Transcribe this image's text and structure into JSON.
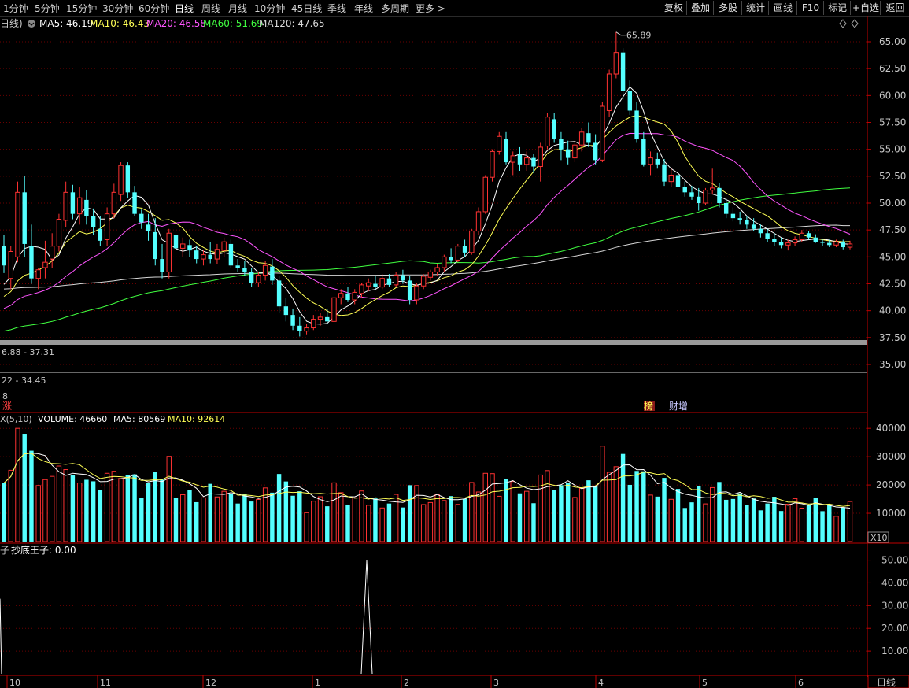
{
  "toolbar": {
    "periods": [
      {
        "label": "1分钟",
        "active": false
      },
      {
        "label": "5分钟",
        "active": false
      },
      {
        "label": "15分钟",
        "active": false
      },
      {
        "label": "30分钟",
        "active": false
      },
      {
        "label": "60分钟",
        "active": false
      },
      {
        "label": "日线",
        "active": true
      },
      {
        "label": "周线",
        "active": false
      },
      {
        "label": "月线",
        "active": false
      },
      {
        "label": "10分钟",
        "active": false
      },
      {
        "label": "45日线",
        "active": false
      },
      {
        "label": "季线",
        "active": false
      },
      {
        "label": "年线",
        "active": false
      },
      {
        "label": "多周期",
        "active": false
      },
      {
        "label": "更多 >",
        "active": false
      }
    ],
    "buttons": [
      "复权",
      "叠加",
      "多股",
      "统计",
      "画线",
      "F10",
      "标记",
      "+自选",
      "返回"
    ]
  },
  "colors": {
    "up": "#ff3232",
    "down": "#54ffff",
    "ma5": "#ffffff",
    "ma10": "#ffff55",
    "ma20": "#ff55ff",
    "ma60": "#40ff40",
    "ma120": "#d8d8d8",
    "axis": "#c00000",
    "grid": "#6a0000"
  },
  "price_panel": {
    "period_label": "日线)",
    "ma_legend": [
      {
        "label": "MA5: 46.19",
        "color": "#ffffff"
      },
      {
        "label": "MA10: 46.43",
        "color": "#ffff55"
      },
      {
        "label": "MA20: 46.58",
        "color": "#ff55ff"
      },
      {
        "label": "MA60: 51.69",
        "color": "#40ff40"
      },
      {
        "label": "MA120: 47.65",
        "color": "#d8d8d8"
      }
    ],
    "y_ticks": [
      "65.00",
      "62.50",
      "60.00",
      "57.50",
      "55.00",
      "52.50",
      "50.00",
      "47.50",
      "45.00",
      "42.50",
      "40.00",
      "37.50",
      "35.00"
    ],
    "high_label": "65.89",
    "band1_label": "6.88 - 37.31",
    "band2_label": "22 - 34.45",
    "marker_8": "8",
    "tag_zhang": "涨",
    "tag_bang": "榜",
    "tag_caizeng": "财增"
  },
  "chart_data": [
    {
      "type": "candlestick",
      "title": "",
      "ylim": [
        33.5,
        66.5
      ],
      "y_ticks": [
        65,
        62.5,
        60,
        57.5,
        55,
        52.5,
        50,
        47.5,
        45,
        42.5,
        40,
        37.5,
        35
      ],
      "x_month_labels": [
        "10",
        "11",
        "12",
        "1",
        "2",
        "3",
        "4",
        "5",
        "6"
      ],
      "ohlc": [
        [
          46,
          47,
          43.5,
          44.2
        ],
        [
          43,
          46,
          42,
          45.5
        ],
        [
          45,
          52,
          44.5,
          51
        ],
        [
          51,
          52.5,
          45,
          46.2
        ],
        [
          46,
          48,
          42.5,
          43
        ],
        [
          43,
          44,
          42,
          43.8
        ],
        [
          44,
          46.5,
          43,
          44.5
        ],
        [
          44.8,
          47.2,
          44,
          46
        ],
        [
          46,
          49,
          45.5,
          48.5
        ],
        [
          48.4,
          52,
          47.8,
          51
        ],
        [
          51,
          51.7,
          48.5,
          49
        ],
        [
          49,
          51.5,
          48,
          50.5
        ],
        [
          50.3,
          51.2,
          48,
          48.8
        ],
        [
          48.8,
          49.5,
          47,
          47.8
        ],
        [
          47.6,
          48.8,
          46,
          46.5
        ],
        [
          46.6,
          49.6,
          46,
          49
        ],
        [
          49,
          51.8,
          48.6,
          51
        ],
        [
          50.8,
          53.8,
          50.2,
          53.5
        ],
        [
          53.5,
          53.8,
          50.5,
          51
        ],
        [
          51,
          51.6,
          48.8,
          49
        ],
        [
          49,
          49.4,
          47.6,
          48.2
        ],
        [
          48,
          49,
          46.5,
          47.4
        ],
        [
          47.3,
          48.6,
          44.2,
          44.8
        ],
        [
          44.8,
          46.2,
          43,
          43.6
        ],
        [
          43.6,
          47.6,
          43,
          47.2
        ],
        [
          47,
          47.6,
          45.5,
          45.8
        ],
        [
          45.8,
          46.8,
          45,
          46.2
        ],
        [
          46.1,
          46.6,
          45,
          45.6
        ],
        [
          45.6,
          46,
          44.4,
          44.8
        ],
        [
          44.8,
          45.6,
          44.2,
          45.2
        ],
        [
          45.2,
          46.4,
          44.4,
          44.8
        ],
        [
          44.8,
          46.2,
          44.3,
          45.7
        ],
        [
          45.6,
          46.8,
          45,
          46.4
        ],
        [
          46.2,
          46.6,
          44,
          44.2
        ],
        [
          44.2,
          44.8,
          43.6,
          44
        ],
        [
          44,
          44.6,
          43.2,
          43.6
        ],
        [
          43.6,
          44,
          42.2,
          42.6
        ],
        [
          42.6,
          43.6,
          42.2,
          43.3
        ],
        [
          43.3,
          44.6,
          42.8,
          44.2
        ],
        [
          44.1,
          44.8,
          42.4,
          42.8
        ],
        [
          42.8,
          43.2,
          39.8,
          40.4
        ],
        [
          40.4,
          41.2,
          39,
          39.6
        ],
        [
          39.6,
          40.2,
          38.2,
          38.6
        ],
        [
          38.6,
          39.4,
          37.6,
          38.1
        ],
        [
          38.1,
          38.8,
          37.8,
          38.4
        ],
        [
          38.4,
          39.6,
          38.2,
          39.2
        ],
        [
          39.2,
          39.8,
          38.6,
          39.4
        ],
        [
          39.4,
          40.2,
          38.8,
          39
        ],
        [
          39,
          41.6,
          38.8,
          41.2
        ],
        [
          41.2,
          42,
          40.6,
          41.6
        ],
        [
          41.6,
          42.2,
          40.8,
          41
        ],
        [
          41,
          42,
          40.6,
          41.7
        ],
        [
          41.6,
          42.6,
          41.2,
          42.4
        ],
        [
          42.3,
          43,
          41.8,
          42.6
        ],
        [
          42.5,
          43.2,
          42,
          42.2
        ],
        [
          42.2,
          43.4,
          42,
          43
        ],
        [
          43,
          43.4,
          42.2,
          42.4
        ],
        [
          42.4,
          43.6,
          42.2,
          43.3
        ],
        [
          43.3,
          43.8,
          42.5,
          42.8
        ],
        [
          42.8,
          43.2,
          40.6,
          41
        ],
        [
          41,
          42.6,
          40.6,
          42.3
        ],
        [
          42.3,
          43.4,
          42,
          43.2
        ],
        [
          43.1,
          43.8,
          42.8,
          43.6
        ],
        [
          43.6,
          44.3,
          43.2,
          44
        ],
        [
          44,
          45.2,
          43.6,
          45
        ],
        [
          45,
          45.8,
          44.4,
          44.7
        ],
        [
          44.7,
          46.2,
          44.5,
          46
        ],
        [
          46,
          46.6,
          45,
          45.4
        ],
        [
          45.4,
          47.6,
          45.2,
          47.4
        ],
        [
          47.4,
          49.6,
          47,
          49.2
        ],
        [
          49.2,
          52.6,
          49,
          52.4
        ],
        [
          52.4,
          55,
          52,
          54.8
        ],
        [
          54.8,
          56.6,
          54.5,
          56.2
        ],
        [
          56,
          56.6,
          53.6,
          53.8
        ],
        [
          53.8,
          54.8,
          52.6,
          54.4
        ],
        [
          54.5,
          55.2,
          53,
          53.6
        ],
        [
          53.6,
          54.8,
          53,
          54.2
        ],
        [
          54.2,
          54.6,
          52.8,
          53.4
        ],
        [
          53.4,
          55.6,
          52,
          55.2
        ],
        [
          55.3,
          58.4,
          55,
          58
        ],
        [
          57.8,
          58.4,
          55.6,
          56
        ],
        [
          56,
          56.6,
          54,
          55
        ],
        [
          55,
          55.8,
          53.6,
          54.2
        ],
        [
          54.2,
          55.8,
          53.8,
          55.4
        ],
        [
          55.4,
          57,
          54.8,
          56.6
        ],
        [
          56.5,
          57.5,
          55.2,
          55.6
        ],
        [
          55.6,
          56.4,
          53.6,
          54
        ],
        [
          54,
          59.4,
          53.8,
          59
        ],
        [
          58.6,
          62.4,
          58,
          62
        ],
        [
          62,
          65.9,
          61.6,
          64
        ],
        [
          64,
          64.4,
          59.6,
          60.4
        ],
        [
          60.4,
          61.4,
          58.2,
          58.6
        ],
        [
          58.6,
          59.4,
          55.6,
          56
        ],
        [
          56,
          56.6,
          53.4,
          53.6
        ],
        [
          53.6,
          54.8,
          52.6,
          54.2
        ],
        [
          54.1,
          54.7,
          53.2,
          53.6
        ],
        [
          53.6,
          54.1,
          51.6,
          52
        ],
        [
          52,
          53.2,
          51.5,
          52.6
        ],
        [
          52.6,
          53.1,
          51.1,
          51.5
        ],
        [
          51.5,
          52,
          50.6,
          51
        ],
        [
          51,
          51.6,
          50.3,
          50.6
        ],
        [
          50.6,
          51.4,
          49.3,
          50
        ],
        [
          50,
          51.4,
          49.8,
          51.2
        ],
        [
          51.2,
          53.2,
          50.8,
          51.4
        ],
        [
          51.4,
          51.9,
          49.6,
          50
        ],
        [
          50,
          50.4,
          48.6,
          49
        ],
        [
          49,
          49.6,
          48.3,
          48.6
        ],
        [
          48.6,
          49.2,
          48,
          48.4
        ],
        [
          48.4,
          48.8,
          47.6,
          48
        ],
        [
          48,
          48.6,
          47.4,
          47.6
        ],
        [
          47.6,
          48,
          46.8,
          47.2
        ],
        [
          47.2,
          47.6,
          46.4,
          46.7
        ],
        [
          46.7,
          47.2,
          46,
          46.4
        ],
        [
          46.4,
          46.8,
          45.8,
          46.1
        ],
        [
          46.1,
          46.6,
          45.6,
          46.3
        ],
        [
          46.3,
          46.9,
          46,
          46.6
        ],
        [
          46.6,
          47.5,
          46.4,
          47.2
        ],
        [
          47.2,
          47.4,
          46.6,
          46.8
        ],
        [
          46.8,
          47.1,
          46.3,
          46.4
        ],
        [
          46.4,
          46.7,
          46,
          46.3
        ],
        [
          46.3,
          46.6,
          45.9,
          46.1
        ],
        [
          46.1,
          46.6,
          45.9,
          46.4
        ],
        [
          46.4,
          46.6,
          45.7,
          45.9
        ],
        [
          45.9,
          46.5,
          45.7,
          46.2
        ]
      ]
    },
    {
      "type": "bar",
      "title": "VOLUME: 46660",
      "legend": [
        "MA5: 80569",
        "MA10: 92614"
      ],
      "y_ticks": [
        40000,
        30000,
        20000,
        10000
      ],
      "ylim": [
        0,
        42000
      ],
      "unit": "X10"
    },
    {
      "type": "line",
      "title": "抄底王子: 0.00",
      "y_ticks": [
        50,
        40,
        30,
        20,
        10
      ],
      "ylim": [
        0,
        54
      ]
    }
  ],
  "volume_panel": {
    "legend_prefix": "X(5,10)",
    "volume_label": "VOLUME: 46660",
    "ma5_label": "MA5: 80569",
    "ma10_label": "MA10: 92614",
    "y_ticks": [
      "40000",
      "30000",
      "20000",
      "10000"
    ],
    "unit": "X10"
  },
  "indicator_panel": {
    "prefix": "子",
    "label": "抄底王子: 0.00",
    "y_ticks": [
      "50.00",
      "40.00",
      "30.00",
      "20.00",
      "10.00"
    ]
  },
  "x_axis": {
    "month_labels": [
      "10",
      "11",
      "12",
      "1",
      "2",
      "3",
      "4",
      "5",
      "6"
    ],
    "period_button": "日线"
  }
}
